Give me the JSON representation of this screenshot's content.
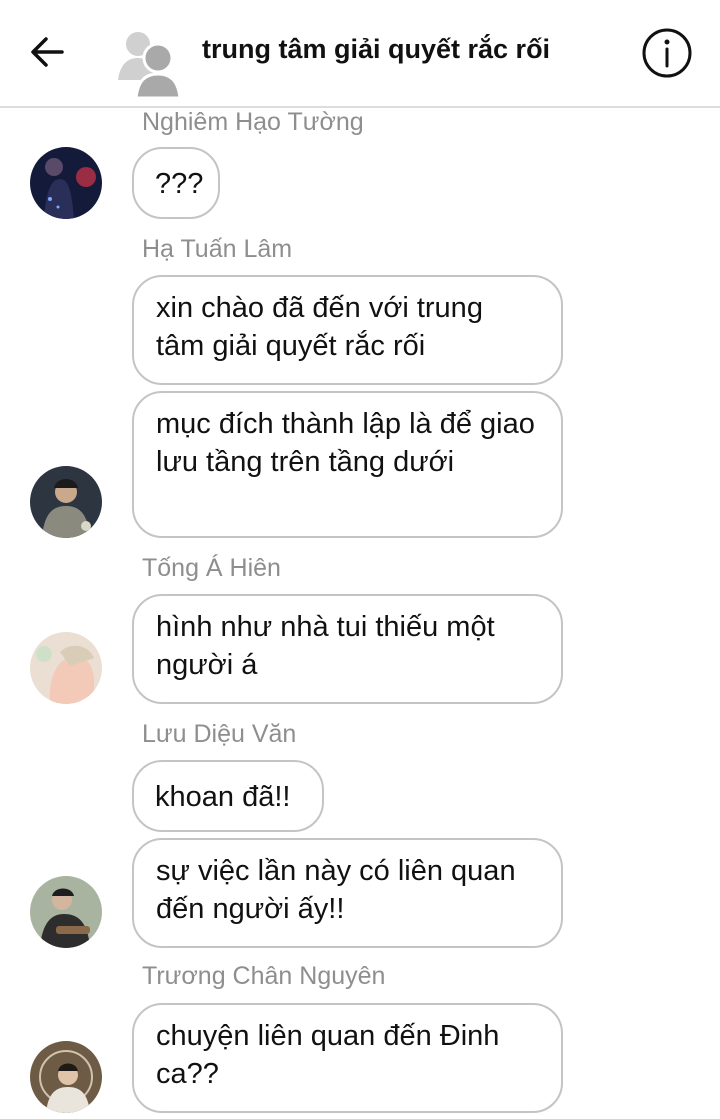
{
  "header": {
    "title": "trung tâm giải quyết rắc rối"
  },
  "messages": [
    {
      "sender": "Nghiêm Hạo Tường",
      "texts": [
        "???"
      ],
      "avatar": "avatar-nghiem-hao-tuong"
    },
    {
      "sender": "Hạ Tuấn Lâm",
      "texts": [
        "xin chào đã đến với trung tâm giải quyết rắc rối",
        "mục đích thành lập là để giao lưu tầng trên tầng dưới"
      ],
      "avatar": "avatar-ha-tuan-lam"
    },
    {
      "sender": "Tống Á Hiên",
      "texts": [
        "hình như nhà tui thiếu một người á"
      ],
      "avatar": "avatar-tong-a-hien"
    },
    {
      "sender": "Lưu Diệu Văn",
      "texts": [
        "khoan đã!!",
        "sự việc lần này có liên quan đến người ấy!!"
      ],
      "avatar": "avatar-luu-dieu-van"
    },
    {
      "sender": "Trương Chân Nguyên",
      "texts": [
        "chuyện liên quan đến Đinh ca??"
      ],
      "avatar": "avatar-truong-chan-nguyen"
    }
  ],
  "colors": {
    "bubble_border": "#c4c4c4",
    "sender_name": "#8e8e8e",
    "divider": "#dcdcdc"
  }
}
